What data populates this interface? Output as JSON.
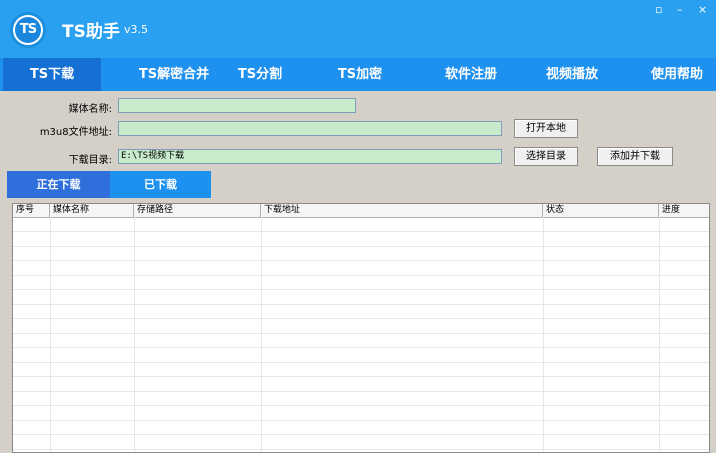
{
  "app": {
    "logo_text": "TS",
    "title": "TS助手",
    "version": "v3.5"
  },
  "window_controls": {
    "restore": "▫",
    "minimize": "–",
    "close": "×"
  },
  "nav": {
    "tabs": [
      {
        "label": "TS下载",
        "active": true
      },
      {
        "label": "TS解密合并"
      },
      {
        "label": "TS分割"
      },
      {
        "label": "TS加密"
      },
      {
        "label": "软件注册"
      },
      {
        "label": "视频播放"
      },
      {
        "label": "使用帮助"
      }
    ]
  },
  "form": {
    "media_name_label": "媒体名称:",
    "media_name_value": "",
    "m3u8_label": "m3u8文件地址:",
    "m3u8_value": "",
    "download_dir_label": "下载目录:",
    "download_dir_value": "E:\\TS视频下载",
    "open_local_btn": "打开本地",
    "choose_dir_btn": "选择目录",
    "add_download_btn": "添加并下载"
  },
  "subtabs": [
    {
      "label": "正在下载",
      "active": true
    },
    {
      "label": "已下载"
    }
  ],
  "table": {
    "columns": [
      "序号",
      "媒体名称",
      "存储路径",
      "下载地址",
      "状态",
      "进度"
    ],
    "rows": []
  },
  "colors": {
    "titlebar": "#2aa0f0",
    "navbar": "#1e90ef",
    "nav_active": "#1570d4",
    "subtab_active": "#2f6fdc",
    "subtab_inactive": "#1e90ef",
    "field_bg": "#c8eccb"
  }
}
